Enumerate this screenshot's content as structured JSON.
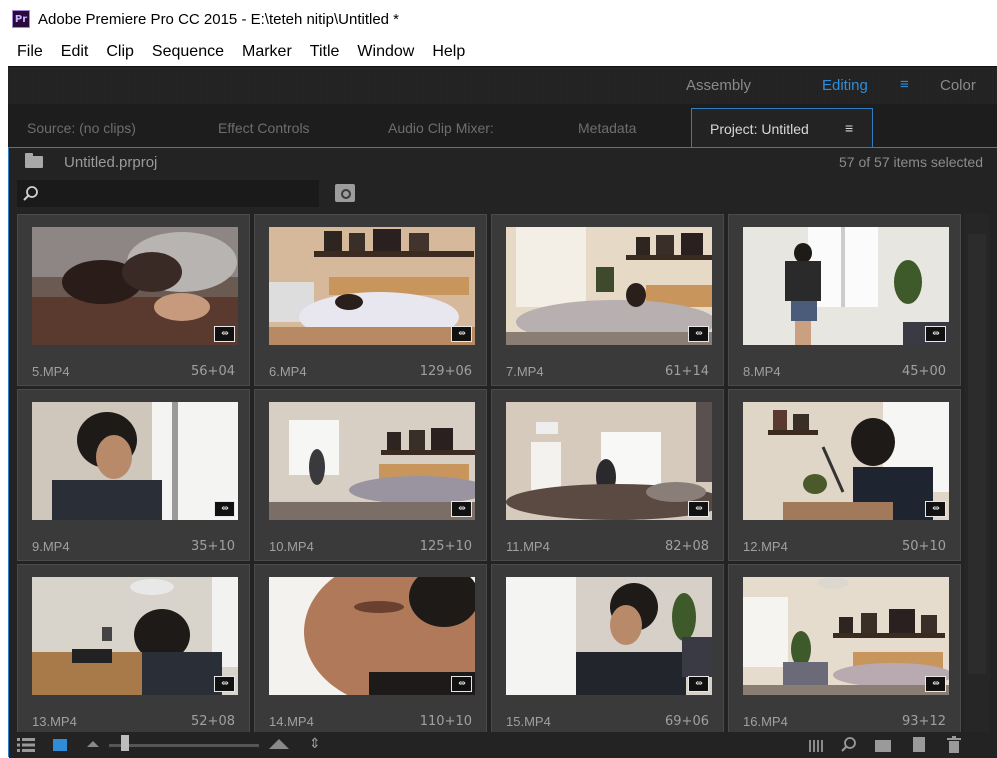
{
  "window": {
    "app_icon_text": "Pr",
    "title": "Adobe Premiere Pro CC 2015 - E:\\teteh nitip\\Untitled *"
  },
  "menu": [
    "File",
    "Edit",
    "Clip",
    "Sequence",
    "Marker",
    "Title",
    "Window",
    "Help"
  ],
  "workspaces": {
    "items": [
      "Assembly",
      "Editing",
      "Color"
    ],
    "active": "Editing",
    "accent": "#2f8dd8"
  },
  "tabs": {
    "inactive": [
      "Source: (no clips)",
      "Effect Controls",
      "Audio Clip Mixer:",
      "Metadata"
    ],
    "active": "Project: Untitled",
    "active_menu_icon": "≡"
  },
  "project": {
    "name": "Untitled.prproj",
    "selection": "57 of 57 items selected",
    "search_value": ""
  },
  "clips": [
    {
      "name": "5.MP4",
      "duration": "56+04"
    },
    {
      "name": "6.MP4",
      "duration": "129+06"
    },
    {
      "name": "7.MP4",
      "duration": "61+14"
    },
    {
      "name": "8.MP4",
      "duration": "45+00"
    },
    {
      "name": "9.MP4",
      "duration": "35+10"
    },
    {
      "name": "10.MP4",
      "duration": "125+10"
    },
    {
      "name": "11.MP4",
      "duration": "82+08"
    },
    {
      "name": "12.MP4",
      "duration": "50+10"
    },
    {
      "name": "13.MP4",
      "duration": "52+08"
    },
    {
      "name": "14.MP4",
      "duration": "110+10"
    },
    {
      "name": "15.MP4",
      "duration": "69+06"
    },
    {
      "name": "16.MP4",
      "duration": "93+12"
    }
  ],
  "badge_glyph": "⇹",
  "bottom_toolbar": {
    "icons": [
      "list-view-icon",
      "icon-view-icon",
      "zoom-small-icon",
      "zoom-slider",
      "zoom-large-icon",
      "sort-icon",
      "automate-to-sequence-icon",
      "find-icon",
      "new-bin-icon",
      "new-item-icon",
      "delete-icon"
    ],
    "sort_glyph": "⇕"
  }
}
